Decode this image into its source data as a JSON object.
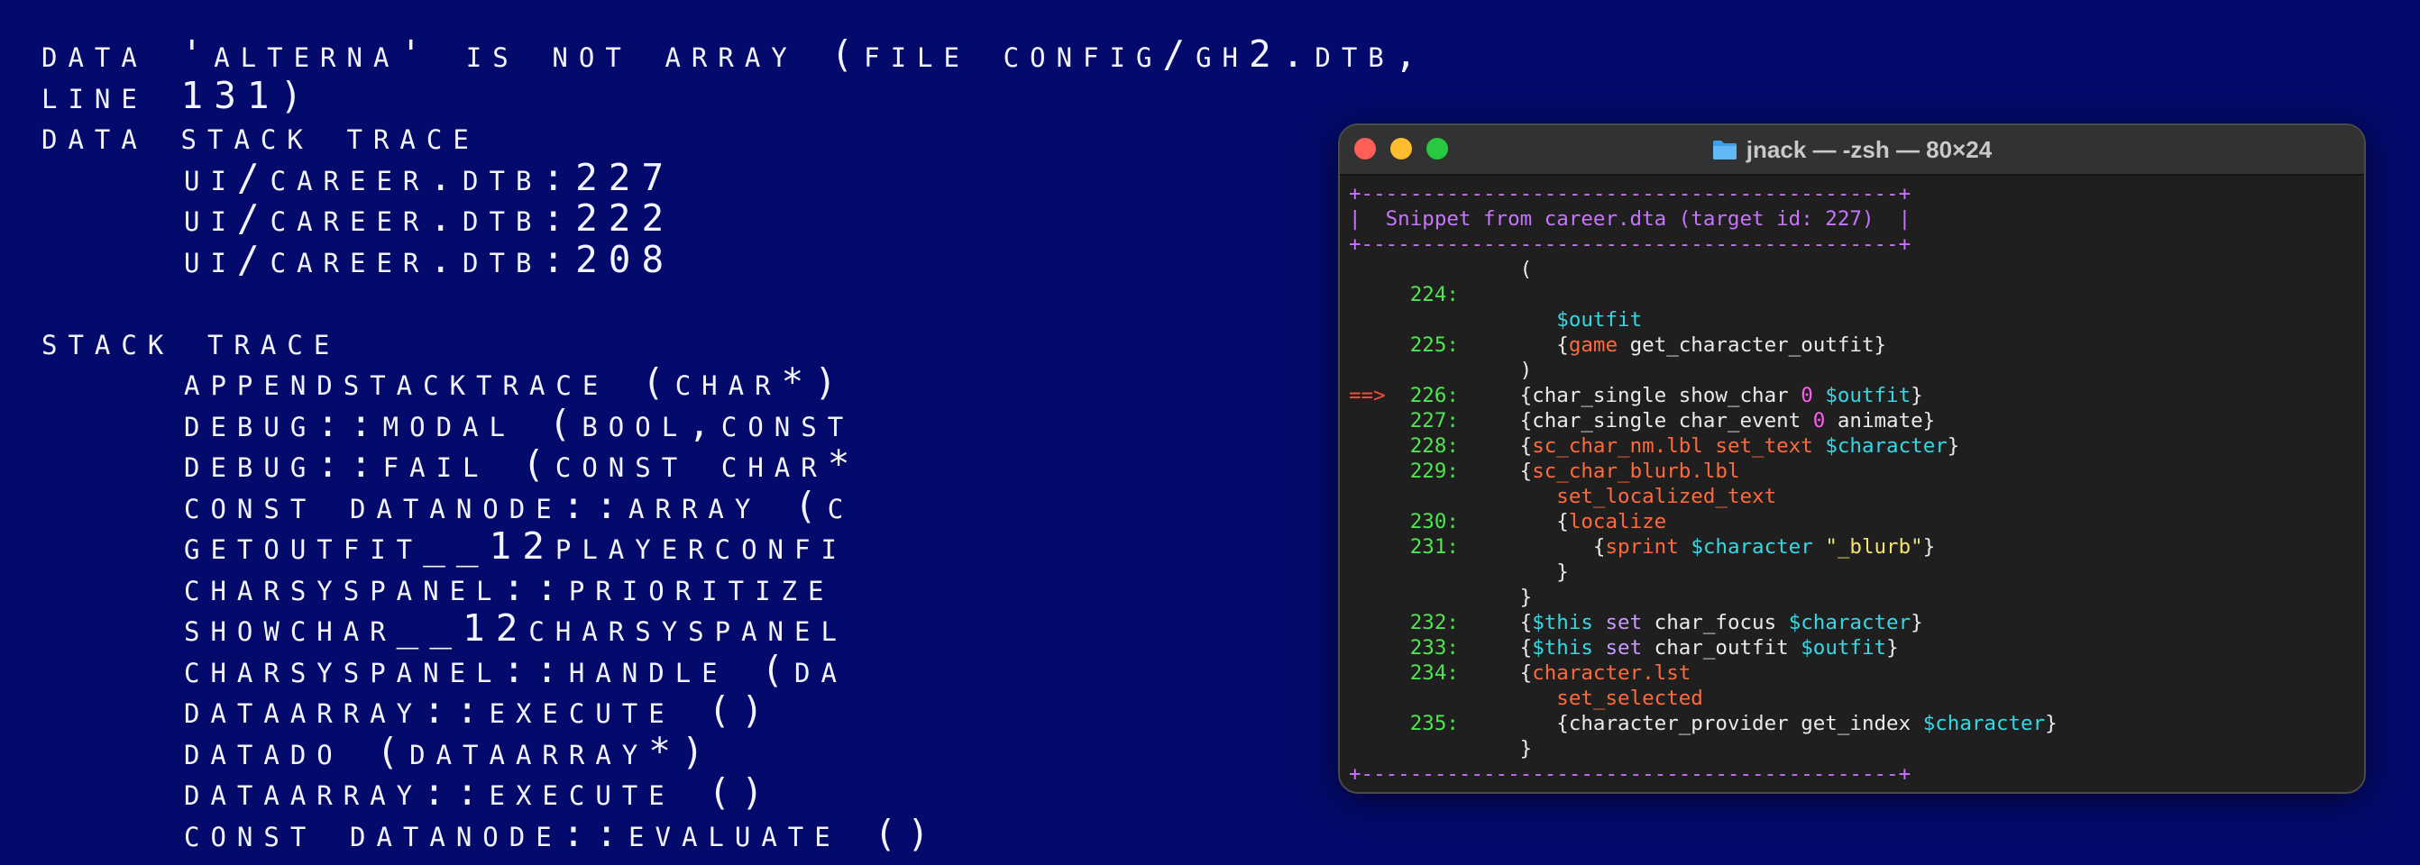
{
  "background": {
    "lines": [
      {
        "text": "Data 'alterna' is not Array (file config/gh2.dtb,",
        "indent": false
      },
      {
        "text": "line 131)",
        "indent": false
      },
      {
        "text": "Data Stack Trace",
        "indent": false
      },
      {
        "text": "ui/career.dtb:227",
        "indent": true
      },
      {
        "text": "ui/career.dtb:222",
        "indent": true
      },
      {
        "text": "ui/career.dtb:208",
        "indent": true
      },
      {
        "text": "",
        "indent": false
      },
      {
        "text": "Stack Trace",
        "indent": false
      },
      {
        "text": "AppendStackTrace (char*)",
        "indent": true
      },
      {
        "text": "Debug::Modal (bool,const",
        "indent": true
      },
      {
        "text": "Debug::Fail (const char*",
        "indent": true
      },
      {
        "text": "const DataNode::Array (c",
        "indent": true
      },
      {
        "text": "GetOutfit__12PlayerConfi",
        "indent": true
      },
      {
        "text": "CharsysPanel::Prioritize",
        "indent": true
      },
      {
        "text": "ShowChar__12CharsysPanel",
        "indent": true
      },
      {
        "text": "CharsysPanel::Handle (Da",
        "indent": true
      },
      {
        "text": "DataArray::Execute ()",
        "indent": true
      },
      {
        "text": "DataDo (DataArray*)",
        "indent": true
      },
      {
        "text": "DataArray::Execute ()",
        "indent": true
      },
      {
        "text": "const DataNode::Evaluate ()",
        "indent": true
      }
    ]
  },
  "terminal": {
    "title": "jnack — -zsh — 80×24",
    "icon": "folder-icon",
    "colors": {
      "border": "#c874ff",
      "line_number": "#4ee64e",
      "arrow": "#ff4b3a",
      "keyword": "#ff6a3d",
      "variable": "#35d9e6",
      "number": "#ff5cf0",
      "this": "#c99aff",
      "string": "#f5e36c"
    },
    "lines": [
      [
        {
          "t": "+--------------------------------------------+",
          "c": "border"
        }
      ],
      [
        {
          "t": "|  Snippet from career.dta (target id: 227)  |",
          "c": "border"
        }
      ],
      [
        {
          "t": "+--------------------------------------------+",
          "c": "border"
        }
      ],
      [
        {
          "t": "              (",
          "c": "white"
        }
      ],
      [
        {
          "t": "     224:",
          "c": "num"
        }
      ],
      [
        {
          "t": "                 ",
          "c": "white"
        },
        {
          "t": "$outfit",
          "c": "cyan"
        }
      ],
      [
        {
          "t": "     225:",
          "c": "num"
        },
        {
          "t": "        {",
          "c": "white"
        },
        {
          "t": "game",
          "c": "red"
        },
        {
          "t": " get_character_outfit}",
          "c": "white"
        }
      ],
      [
        {
          "t": "              )",
          "c": "white"
        }
      ],
      [
        {
          "t": "==> ",
          "c": "arrow"
        },
        {
          "t": " 226:",
          "c": "num"
        },
        {
          "t": "     {char_single show_char ",
          "c": "white"
        },
        {
          "t": "0",
          "c": "mag"
        },
        {
          "t": " ",
          "c": "white"
        },
        {
          "t": "$outfit",
          "c": "cyan"
        },
        {
          "t": "}",
          "c": "white"
        }
      ],
      [
        {
          "t": "     227:",
          "c": "num"
        },
        {
          "t": "     {char_single char_event ",
          "c": "white"
        },
        {
          "t": "0",
          "c": "mag"
        },
        {
          "t": " animate}",
          "c": "white"
        }
      ],
      [
        {
          "t": "     228:",
          "c": "num"
        },
        {
          "t": "     {",
          "c": "white"
        },
        {
          "t": "sc_char_nm.lbl",
          "c": "red"
        },
        {
          "t": " ",
          "c": "white"
        },
        {
          "t": "set_text",
          "c": "red"
        },
        {
          "t": " ",
          "c": "white"
        },
        {
          "t": "$character",
          "c": "cyan"
        },
        {
          "t": "}",
          "c": "white"
        }
      ],
      [
        {
          "t": "     229:",
          "c": "num"
        },
        {
          "t": "     {",
          "c": "white"
        },
        {
          "t": "sc_char_blurb.lbl",
          "c": "red"
        }
      ],
      [
        {
          "t": "                 ",
          "c": "white"
        },
        {
          "t": "set_localized_text",
          "c": "red"
        }
      ],
      [
        {
          "t": "     230:",
          "c": "num"
        },
        {
          "t": "        {",
          "c": "white"
        },
        {
          "t": "localize",
          "c": "red"
        }
      ],
      [
        {
          "t": "     231:",
          "c": "num"
        },
        {
          "t": "           {",
          "c": "white"
        },
        {
          "t": "sprint",
          "c": "red"
        },
        {
          "t": " ",
          "c": "white"
        },
        {
          "t": "$character",
          "c": "cyan"
        },
        {
          "t": " ",
          "c": "white"
        },
        {
          "t": "\"_blurb\"",
          "c": "yellow"
        },
        {
          "t": "}",
          "c": "white"
        }
      ],
      [
        {
          "t": "                 }",
          "c": "white"
        }
      ],
      [
        {
          "t": "              }",
          "c": "white"
        }
      ],
      [
        {
          "t": "     232:",
          "c": "num"
        },
        {
          "t": "     {",
          "c": "white"
        },
        {
          "t": "$this",
          "c": "cyan"
        },
        {
          "t": " ",
          "c": "white"
        },
        {
          "t": "set",
          "c": "purple"
        },
        {
          "t": " char_focus ",
          "c": "white"
        },
        {
          "t": "$character",
          "c": "cyan"
        },
        {
          "t": "}",
          "c": "white"
        }
      ],
      [
        {
          "t": "     233:",
          "c": "num"
        },
        {
          "t": "     {",
          "c": "white"
        },
        {
          "t": "$this",
          "c": "cyan"
        },
        {
          "t": " ",
          "c": "white"
        },
        {
          "t": "set",
          "c": "purple"
        },
        {
          "t": " char_outfit ",
          "c": "white"
        },
        {
          "t": "$outfit",
          "c": "cyan"
        },
        {
          "t": "}",
          "c": "white"
        }
      ],
      [
        {
          "t": "     234:",
          "c": "num"
        },
        {
          "t": "     {",
          "c": "white"
        },
        {
          "t": "character.lst",
          "c": "red"
        }
      ],
      [
        {
          "t": "                 ",
          "c": "white"
        },
        {
          "t": "set_selected",
          "c": "red"
        }
      ],
      [
        {
          "t": "     235:",
          "c": "num"
        },
        {
          "t": "        {character_provider get_index ",
          "c": "white"
        },
        {
          "t": "$character",
          "c": "cyan"
        },
        {
          "t": "}",
          "c": "white"
        }
      ],
      [
        {
          "t": "              }",
          "c": "white"
        }
      ],
      [
        {
          "t": "+--------------------------------------------+",
          "c": "border"
        }
      ]
    ]
  }
}
